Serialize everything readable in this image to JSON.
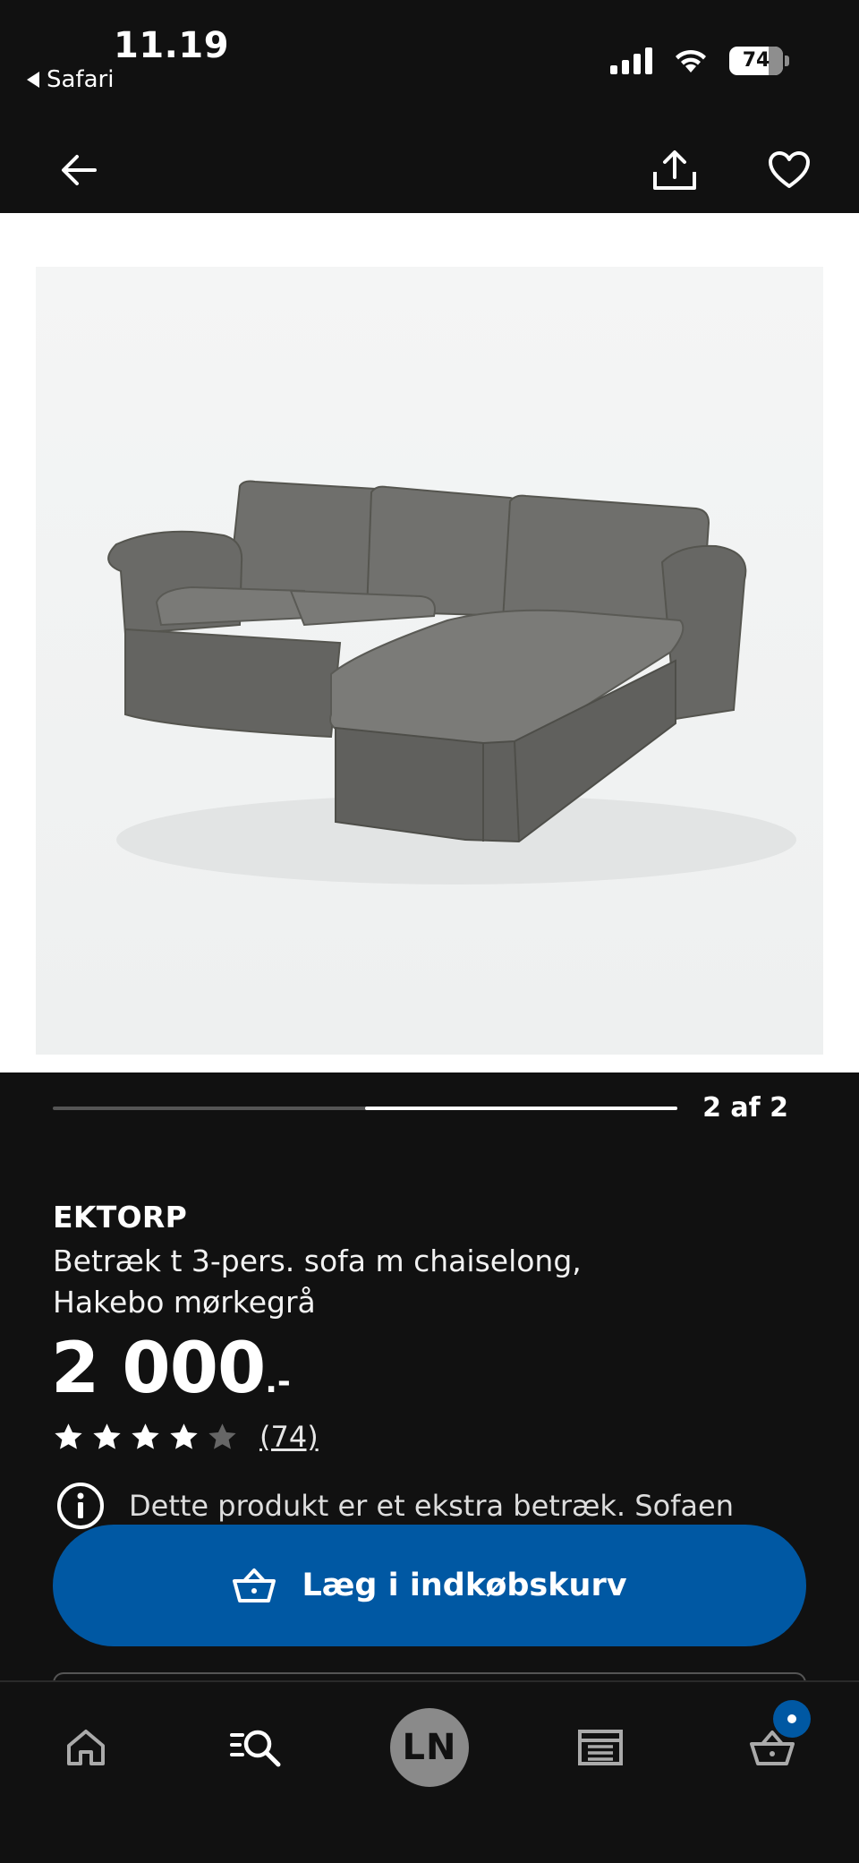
{
  "status_bar": {
    "time": "11.19",
    "back_app": "Safari",
    "battery_percent": "74",
    "battery_level": 0.74
  },
  "product": {
    "brand": "EKTORP",
    "description_line1": "Betræk t 3-pers. sofa m chaiselong,",
    "description_line2": "Hakebo mørkegrå",
    "price_main": "2 000",
    "price_suffix": ".-",
    "rating": 4,
    "rating_max": 5,
    "review_count": "(74)",
    "notice": "Dette produkt er et ekstra betræk. Sofaen"
  },
  "gallery": {
    "counter": "2 af 2",
    "current_image": 2,
    "total_images": 2
  },
  "cart_button": {
    "label": "Læg i indkøbskurv"
  },
  "bottom_nav": {
    "avatar_initials": "LN",
    "items": [
      "home-icon",
      "search-icon",
      "avatar",
      "store-icon",
      "basket-icon"
    ]
  },
  "colors": {
    "background": "#111111",
    "accent_blue": "#0058a3",
    "sofa_gray": "#6b6b69",
    "photo_bg": "#f4f5f5"
  }
}
